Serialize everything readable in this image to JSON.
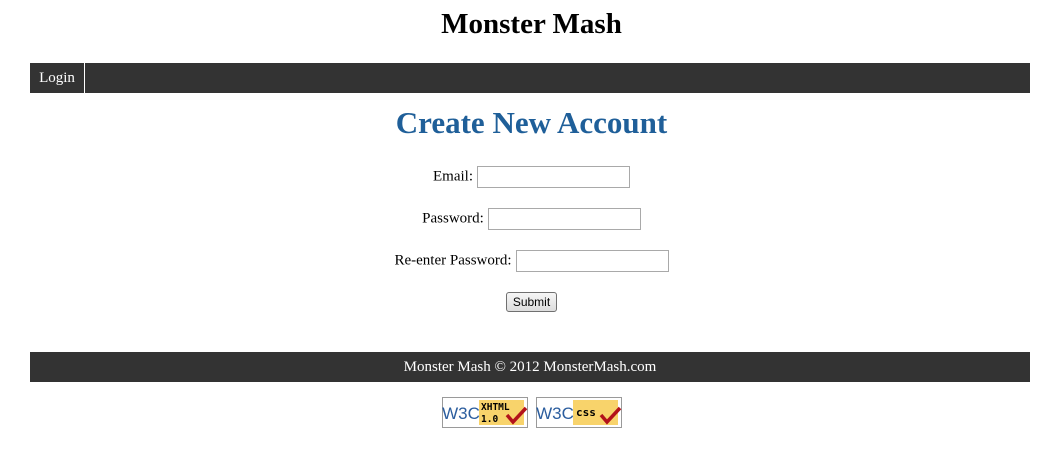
{
  "site": {
    "title": "Monster Mash"
  },
  "nav": {
    "items": [
      {
        "label": "Login"
      }
    ]
  },
  "page": {
    "heading": "Create New Account"
  },
  "form": {
    "email_label": "Email:",
    "email_value": "",
    "password_label": "Password:",
    "password_value": "",
    "repassword_label": "Re-enter Password:",
    "repassword_value": "",
    "submit_label": "Submit"
  },
  "footer": {
    "text": "Monster Mash © 2012 MonsterMash.com"
  },
  "badges": [
    {
      "logo": "W3C",
      "text_line1": "XHTML",
      "text_line2": "1.0",
      "icon": "checkmark-icon"
    },
    {
      "logo": "W3C",
      "text_line1": "css",
      "icon": "checkmark-icon"
    }
  ],
  "colors": {
    "nav_background": "#333333",
    "heading": "#1f5f99",
    "badge_yellow": "#f8d36b",
    "w3c_blue": "#2b5d9e",
    "check_red": "#b3121a"
  }
}
